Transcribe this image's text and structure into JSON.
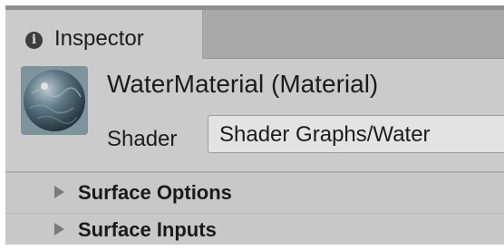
{
  "inspector_tab": {
    "icon": "info-icon",
    "label": "Inspector"
  },
  "material": {
    "title": "WaterMaterial (Material)",
    "preview_icon": "material-sphere-preview"
  },
  "shader": {
    "label": "Shader",
    "value": "Shader Graphs/Water"
  },
  "sections": [
    {
      "label": "Surface Options",
      "icon": "foldout-arrow-icon"
    },
    {
      "label": "Surface Inputs",
      "icon": "foldout-arrow-icon"
    }
  ],
  "colors": {
    "panel_bg": "#c8c8c8",
    "tab_strip_bg": "#a9a9a9",
    "field_bg": "#e3e3e3",
    "text": "#1c1c1c"
  }
}
